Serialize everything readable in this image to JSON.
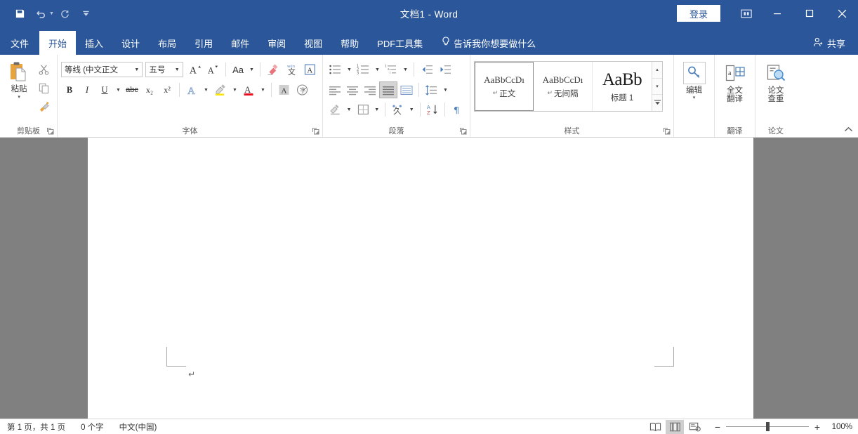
{
  "titlebar": {
    "document_title": "文档1  -  Word",
    "quick_access": [
      {
        "name": "save",
        "icon": "save-icon"
      },
      {
        "name": "undo",
        "icon": "undo-icon"
      },
      {
        "name": "redo",
        "icon": "redo-icon"
      },
      {
        "name": "customize-qat",
        "icon": "chevron-down-icon"
      }
    ],
    "signin_label": "登录",
    "ribbon_display_options": "ribbon-display-options-icon",
    "minimize": "minimize-icon",
    "maximize": "maximize-icon",
    "close": "close-icon"
  },
  "tabs": [
    {
      "label": "文件",
      "active": false
    },
    {
      "label": "开始",
      "active": true
    },
    {
      "label": "插入",
      "active": false
    },
    {
      "label": "设计",
      "active": false
    },
    {
      "label": "布局",
      "active": false
    },
    {
      "label": "引用",
      "active": false
    },
    {
      "label": "邮件",
      "active": false
    },
    {
      "label": "审阅",
      "active": false
    },
    {
      "label": "视图",
      "active": false
    },
    {
      "label": "帮助",
      "active": false
    },
    {
      "label": "PDF工具集",
      "active": false
    }
  ],
  "tellme": {
    "label": "告诉我你想要做什么",
    "icon": "lightbulb-icon"
  },
  "share": {
    "label": "共享",
    "icon": "share-person-icon"
  },
  "ribbon": {
    "collapse_label": "⌃",
    "groups": {
      "clipboard": {
        "label": "剪贴板",
        "paste_label": "粘贴",
        "paste_caret": "▾",
        "cut": "剪切",
        "copy": "复制",
        "format_painter": "格式刷"
      },
      "font": {
        "label": "字体",
        "font_name": "等线 (中文正文",
        "font_size": "五号",
        "grow_font": "A",
        "shrink_font": "A",
        "change_case": "Aa",
        "clear_formatting": "清除所有格式",
        "phonetic_guide": "拼音指南",
        "char_border": "A",
        "bold": "B",
        "italic": "I",
        "underline": "U",
        "strikethrough": "abc",
        "subscript": "x₂",
        "superscript": "x²",
        "text_effects": "A",
        "highlight": "A",
        "font_color": "A",
        "char_shading": "A",
        "enclose_char": "字"
      },
      "paragraph": {
        "label": "段落",
        "bullets": "项目符号",
        "numbering": "编号",
        "multilevel": "多级列表",
        "decrease_indent": "减少缩进量",
        "increase_indent": "增加缩进量",
        "align_left": "左对齐",
        "align_center": "居中",
        "align_right": "右对齐",
        "justify": "两端对齐",
        "distribute": "分散对齐",
        "line_spacing": "行和段落间距",
        "shading": "底纹",
        "borders": "边框",
        "asian_layout": "中文版式",
        "sort": "排序",
        "show_marks": "显示/隐藏编辑标记"
      },
      "styles": {
        "label": "样式",
        "items": [
          {
            "preview": "AaBbCcDı",
            "name": "正文",
            "pilcrow": "↵",
            "selected": true,
            "big": false
          },
          {
            "preview": "AaBbCcDı",
            "name": "无间隔",
            "pilcrow": "↵",
            "selected": false,
            "big": false
          },
          {
            "preview": "AaBb",
            "name": "标题 1",
            "pilcrow": "",
            "selected": false,
            "big": true
          }
        ],
        "scroll_up": "▴",
        "scroll_down": "▾",
        "more": "▾"
      },
      "edit": {
        "label": "编辑",
        "button_label": "编辑",
        "caret": "▾",
        "icon": "magnifier-key-icon"
      },
      "translate": {
        "label": "翻译",
        "button_label": "全文\n翻译",
        "line1": "全文",
        "line2": "翻译",
        "icon": "translate-icon"
      },
      "paper": {
        "label": "论文",
        "line1": "论文",
        "line2": "查重",
        "icon": "paper-check-icon"
      }
    }
  },
  "document": {
    "paragraph_mark": "↵"
  },
  "statusbar": {
    "page_info": "第 1 页，共 1 页",
    "word_count": "0 个字",
    "language": "中文(中国)",
    "views": [
      {
        "name": "read-mode",
        "icon": "read-mode-icon",
        "selected": false
      },
      {
        "name": "print-layout",
        "icon": "print-layout-icon",
        "selected": true
      },
      {
        "name": "web-layout",
        "icon": "web-layout-icon",
        "selected": false
      }
    ],
    "zoom_out": "−",
    "zoom_in": "+",
    "zoom_value": "100%"
  },
  "colors": {
    "word_blue": "#2b579a",
    "ribbon_bg": "#ffffff",
    "doc_bg": "#808080",
    "accent_orange": "#e8a33d"
  }
}
